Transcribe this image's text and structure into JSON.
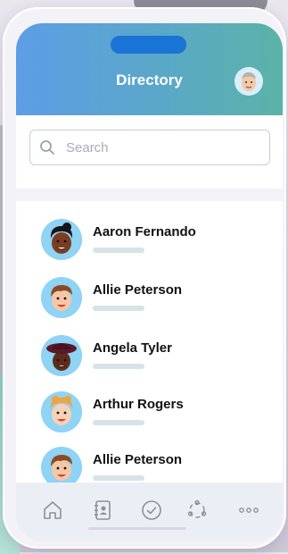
{
  "header": {
    "title": "Directory",
    "avatar_icon": "user-avatar-icon"
  },
  "search": {
    "placeholder": "Search",
    "icon": "search-icon"
  },
  "contacts": [
    {
      "name": "Aaron Fernando",
      "avatar": "avatar-dark-hair-icon"
    },
    {
      "name": "Allie Peterson",
      "avatar": "avatar-brown-hair-icon"
    },
    {
      "name": "Angela Tyler",
      "avatar": "avatar-hat-icon"
    },
    {
      "name": "Arthur Rogers",
      "avatar": "avatar-orange-hair-icon"
    },
    {
      "name": "Allie Peterson",
      "avatar": "avatar-brown-hair-icon"
    }
  ],
  "tabs": [
    {
      "icon": "home-icon"
    },
    {
      "icon": "contacts-book-icon"
    },
    {
      "icon": "check-circle-icon"
    },
    {
      "icon": "network-icon"
    },
    {
      "icon": "more-icon"
    }
  ],
  "colors": {
    "header_gradient_start": "#5d9de6",
    "header_gradient_end": "#5ab3a6",
    "notch": "#1a74d6",
    "avatar_bg": "#8fd3f5"
  }
}
